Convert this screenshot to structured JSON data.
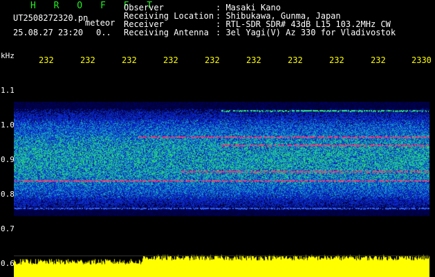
{
  "header": {
    "app_title": "H R O F F T",
    "filename": "UT2508272320.pn",
    "meteor_label": "meteor",
    "datetime": "25.08.27 23:20",
    "count": "0.."
  },
  "info": {
    "labels": [
      "Observer",
      "Receiving Location",
      "Receiver",
      "Receiving Antenna"
    ],
    "values": [
      ": Masaki Kano",
      ": Shibukawa, Gunma, Japan",
      ": RTL-SDR SDR# 43dB L15 103.2MHz CW",
      ": 3el Yagi(V) Az 330 for Vladivostok"
    ]
  },
  "axis": {
    "y_unit": "kHz",
    "y_ticks": [
      "1.1",
      "1.0",
      "0.9",
      "0.8",
      "0.7",
      "0.6"
    ],
    "x_ticks": [
      "232",
      "232",
      "232",
      "232",
      "232",
      "232",
      "232",
      "232",
      "232",
      "2330"
    ]
  },
  "colors": {
    "background": "#000000",
    "title": "#22ee22",
    "tick_x": "#ffff00",
    "signal_low": "#0a1a9a",
    "signal_mid": "#22dd66",
    "signal_high": "#ff3377",
    "power_trace": "#ffff00"
  }
}
